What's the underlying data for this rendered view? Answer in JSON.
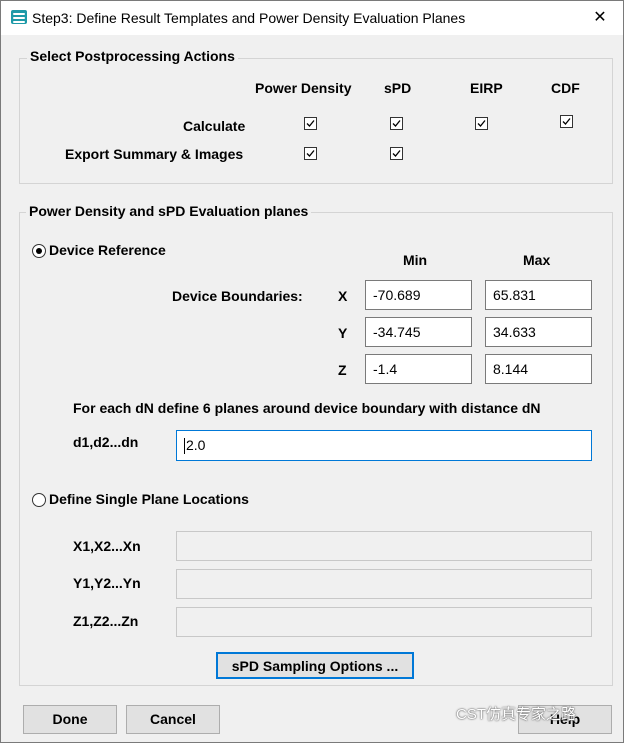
{
  "window": {
    "title": "Step3: Define Result Templates and Power Density Evaluation Planes",
    "close_glyph": "✕"
  },
  "actions": {
    "group_label": "Select Postprocessing Actions",
    "columns": [
      "Power Density",
      "sPD",
      "EIRP",
      "CDF"
    ],
    "rows": [
      {
        "label": "Calculate",
        "checks": [
          true,
          true,
          true,
          true
        ]
      },
      {
        "label": "Export Summary & Images",
        "checks": [
          true,
          true
        ]
      }
    ]
  },
  "planes": {
    "group_label": "Power Density and sPD Evaluation planes",
    "device_reference_label": "Device Reference",
    "device_reference_selected": true,
    "min_header": "Min",
    "max_header": "Max",
    "boundaries_label": "Device Boundaries:",
    "axes": [
      {
        "axis": "X",
        "min": "-70.689",
        "max": "65.831"
      },
      {
        "axis": "Y",
        "min": "-34.745",
        "max": "34.633"
      },
      {
        "axis": "Z",
        "min": "-1.4",
        "max": "8.144"
      }
    ],
    "dn_description": "For each dN define 6 planes around device boundary with distance dN",
    "dn_label": "d1,d2...dn",
    "dn_value": "2.0",
    "single_plane_label": "Define Single Plane Locations",
    "single_plane_selected": false,
    "single_rows": [
      {
        "label": "X1,X2...Xn",
        "value": ""
      },
      {
        "label": "Y1,Y2...Yn",
        "value": ""
      },
      {
        "label": "Z1,Z2...Zn",
        "value": ""
      }
    ],
    "sampling_button": "sPD Sampling Options ..."
  },
  "footer": {
    "done": "Done",
    "cancel": "Cancel",
    "help": "Help"
  },
  "watermark": "CST仿真专家之路"
}
